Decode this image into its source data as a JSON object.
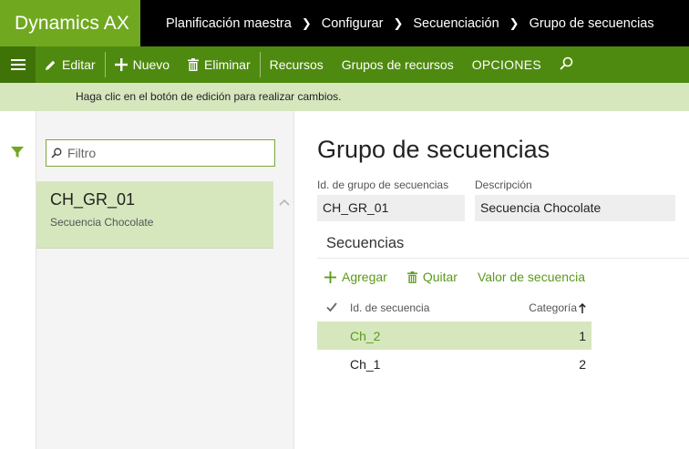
{
  "app": {
    "title": "Dynamics AX"
  },
  "breadcrumb": [
    "Planificación maestra",
    "Configurar",
    "Secuenciación",
    "Grupo de secuencias"
  ],
  "actionbar": {
    "edit": "Editar",
    "new": "Nuevo",
    "delete": "Eliminar",
    "resources": "Recursos",
    "resource_groups": "Grupos de recursos",
    "options": "OPCIONES"
  },
  "infobar": {
    "message": "Haga clic en el botón de edición para realizar cambios."
  },
  "list": {
    "search_placeholder": "Filtro",
    "items": [
      {
        "title": "CH_GR_01",
        "subtitle": "Secuencia Chocolate"
      }
    ]
  },
  "detail": {
    "title": "Grupo de secuencias",
    "id_label": "Id. de grupo de secuencias",
    "id_value": "CH_GR_01",
    "desc_label": "Descripción",
    "desc_value": "Secuencia Chocolate",
    "section_title": "Secuencias",
    "actions": {
      "add": "Agregar",
      "remove": "Quitar",
      "sequence_value": "Valor de secuencia"
    },
    "grid": {
      "columns": [
        "Id. de secuencia",
        "Categoría"
      ],
      "rows": [
        {
          "id": "Ch_2",
          "category": "1"
        },
        {
          "id": "Ch_1",
          "category": "2"
        }
      ]
    }
  },
  "colors": {
    "brand": "#70a91f",
    "actionbar": "#4f8a10",
    "highlight": "#d6e7be",
    "link": "#5a9a1a"
  }
}
